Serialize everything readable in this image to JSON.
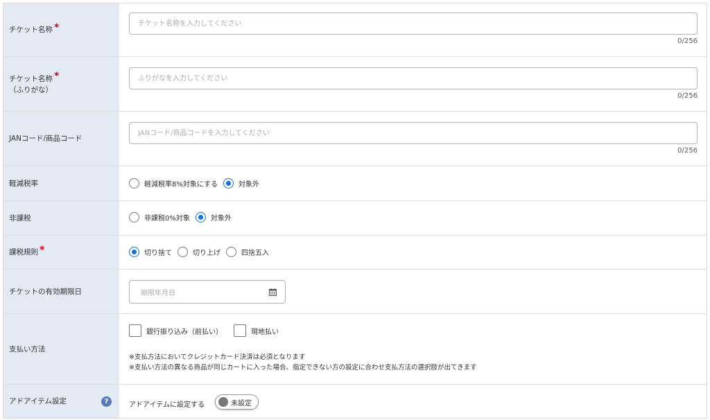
{
  "fields": {
    "ticket_name": {
      "label": "チケット名称",
      "required": "*",
      "placeholder": "チケット名称を入力してください",
      "counter": "0/256"
    },
    "ticket_kana": {
      "label_line1": "チケット名称",
      "label_line2": "（ふりがな）",
      "required": "*",
      "placeholder": "ふりがなを入力してください",
      "counter": "0/256"
    },
    "jan_code": {
      "label": "JANコード/商品コード",
      "placeholder": "JANコード/商品コードを入力してください",
      "counter": "0/256"
    },
    "reduced_tax": {
      "label": "軽減税率",
      "options": [
        "軽減税率8%対象にする",
        "対象外"
      ],
      "selected": 1
    },
    "tax_exempt": {
      "label": "非課税",
      "options": [
        "非課税0%対象",
        "対象外"
      ],
      "selected": 1
    },
    "tax_rounding": {
      "label": "課税規則",
      "required": "*",
      "options": [
        "切り捨て",
        "切り上げ",
        "四捨五入"
      ],
      "selected": 0
    },
    "expiry": {
      "label": "チケットの有効期限日",
      "placeholder": "期限年月日"
    },
    "payment": {
      "label": "支払い方法",
      "options": [
        "銀行振り込み（前払い）",
        "現地払い"
      ],
      "notes": [
        "※支払方法においてクレジットカード決済は必須となります",
        "※支払い方法の異なる商品が同じカートに入った場合、指定できない方の設定に合わせ支払方法の選択肢が出てきます"
      ]
    },
    "add_item": {
      "label": "アドアイテム設定",
      "help": "?",
      "toggle_label": "アドアイテムに設定する",
      "toggle_state": "未設定"
    }
  },
  "colors": {
    "label_bg": "#e3eaf4",
    "required": "#d0021b",
    "accent": "#1a6fd4",
    "help_icon": "#5a7ab5"
  }
}
